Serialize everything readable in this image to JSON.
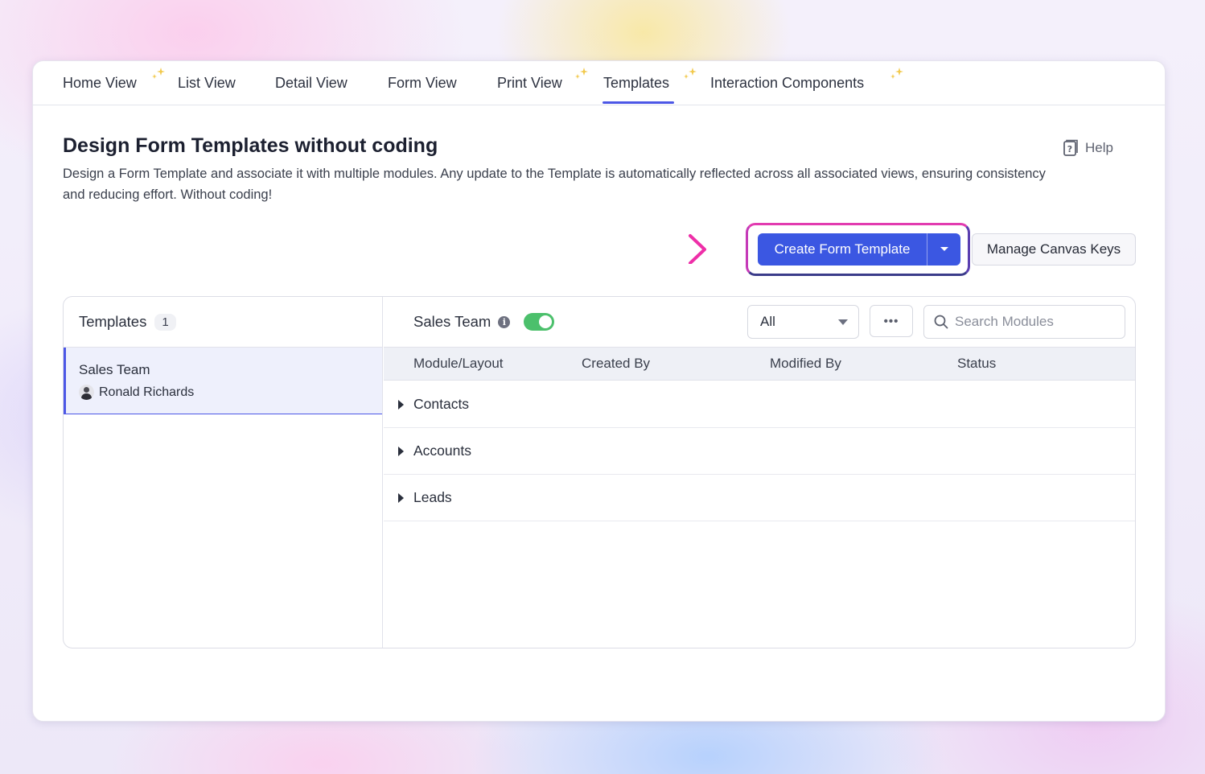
{
  "tabs": [
    {
      "label": "Home View",
      "sparkle": true
    },
    {
      "label": "List View",
      "sparkle": false
    },
    {
      "label": "Detail View",
      "sparkle": false
    },
    {
      "label": "Form View",
      "sparkle": false
    },
    {
      "label": "Print View",
      "sparkle": true
    },
    {
      "label": "Templates",
      "sparkle": true,
      "active": true
    },
    {
      "label": "Interaction Components",
      "sparkle": true
    }
  ],
  "header": {
    "title": "Design Form Templates without coding",
    "description": "Design a Form Template and associate it with multiple modules. Any update to the Template is automatically reflected across all associated views, ensuring consistency and reducing effort. Without coding!",
    "help_label": "Help"
  },
  "actions": {
    "create_label": "Create Form Template",
    "manage_label": "Manage Canvas Keys"
  },
  "templates_panel": {
    "heading": "Templates",
    "count": "1",
    "items": [
      {
        "name": "Sales Team",
        "owner": "Ronald Richards",
        "selected": true
      }
    ]
  },
  "detail": {
    "title": "Sales Team",
    "enabled": true,
    "filter_value": "All",
    "more_label": "•••",
    "search_placeholder": "Search Modules",
    "columns": [
      "Module/Layout",
      "Created By",
      "Modified By",
      "Status"
    ],
    "rows": [
      "Contacts",
      "Accounts",
      "Leads"
    ]
  },
  "colors": {
    "accent": "#3b57e2",
    "toggle_on": "#4cc06c",
    "highlight_border": "#e23bb0",
    "sparkle": "#f2c94c"
  }
}
